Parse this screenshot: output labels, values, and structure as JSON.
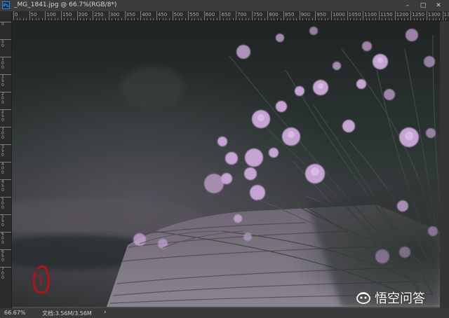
{
  "window": {
    "title": "_MG_1841.jpg @ 66.7%(RGB/8*)",
    "app_icon": "photoshop-icon",
    "minimize_icon": "minimize-icon",
    "maximize_icon": "maximize-icon",
    "close_icon": "close-icon"
  },
  "ruler": {
    "horizontal_labels": [
      "0",
      "50",
      "100",
      "150",
      "200",
      "250",
      "300",
      "350",
      "400",
      "450",
      "500",
      "550",
      "600",
      "650",
      "700",
      "750",
      "800",
      "850",
      "900",
      "950",
      "1000",
      "1050",
      "1100",
      "1150",
      "1200",
      "1250",
      "1300",
      "135"
    ],
    "vertical_labels": [
      "0",
      "50",
      "100",
      "150",
      "200",
      "250",
      "300",
      "350",
      "400",
      "450",
      "500",
      "550",
      "600",
      "650",
      "700"
    ]
  },
  "status": {
    "zoom": "66.67%",
    "doc_info": "文档:3.56M/3.56M",
    "arrow": "›"
  },
  "watermark": {
    "text": "悟空问答",
    "icon": "wukong-logo-icon"
  },
  "colors": {
    "workspace": "#4a4a4a",
    "ruler_bg": "#2b2b2b",
    "flower": "#c6a3d3",
    "foliage": "#3b4540"
  }
}
